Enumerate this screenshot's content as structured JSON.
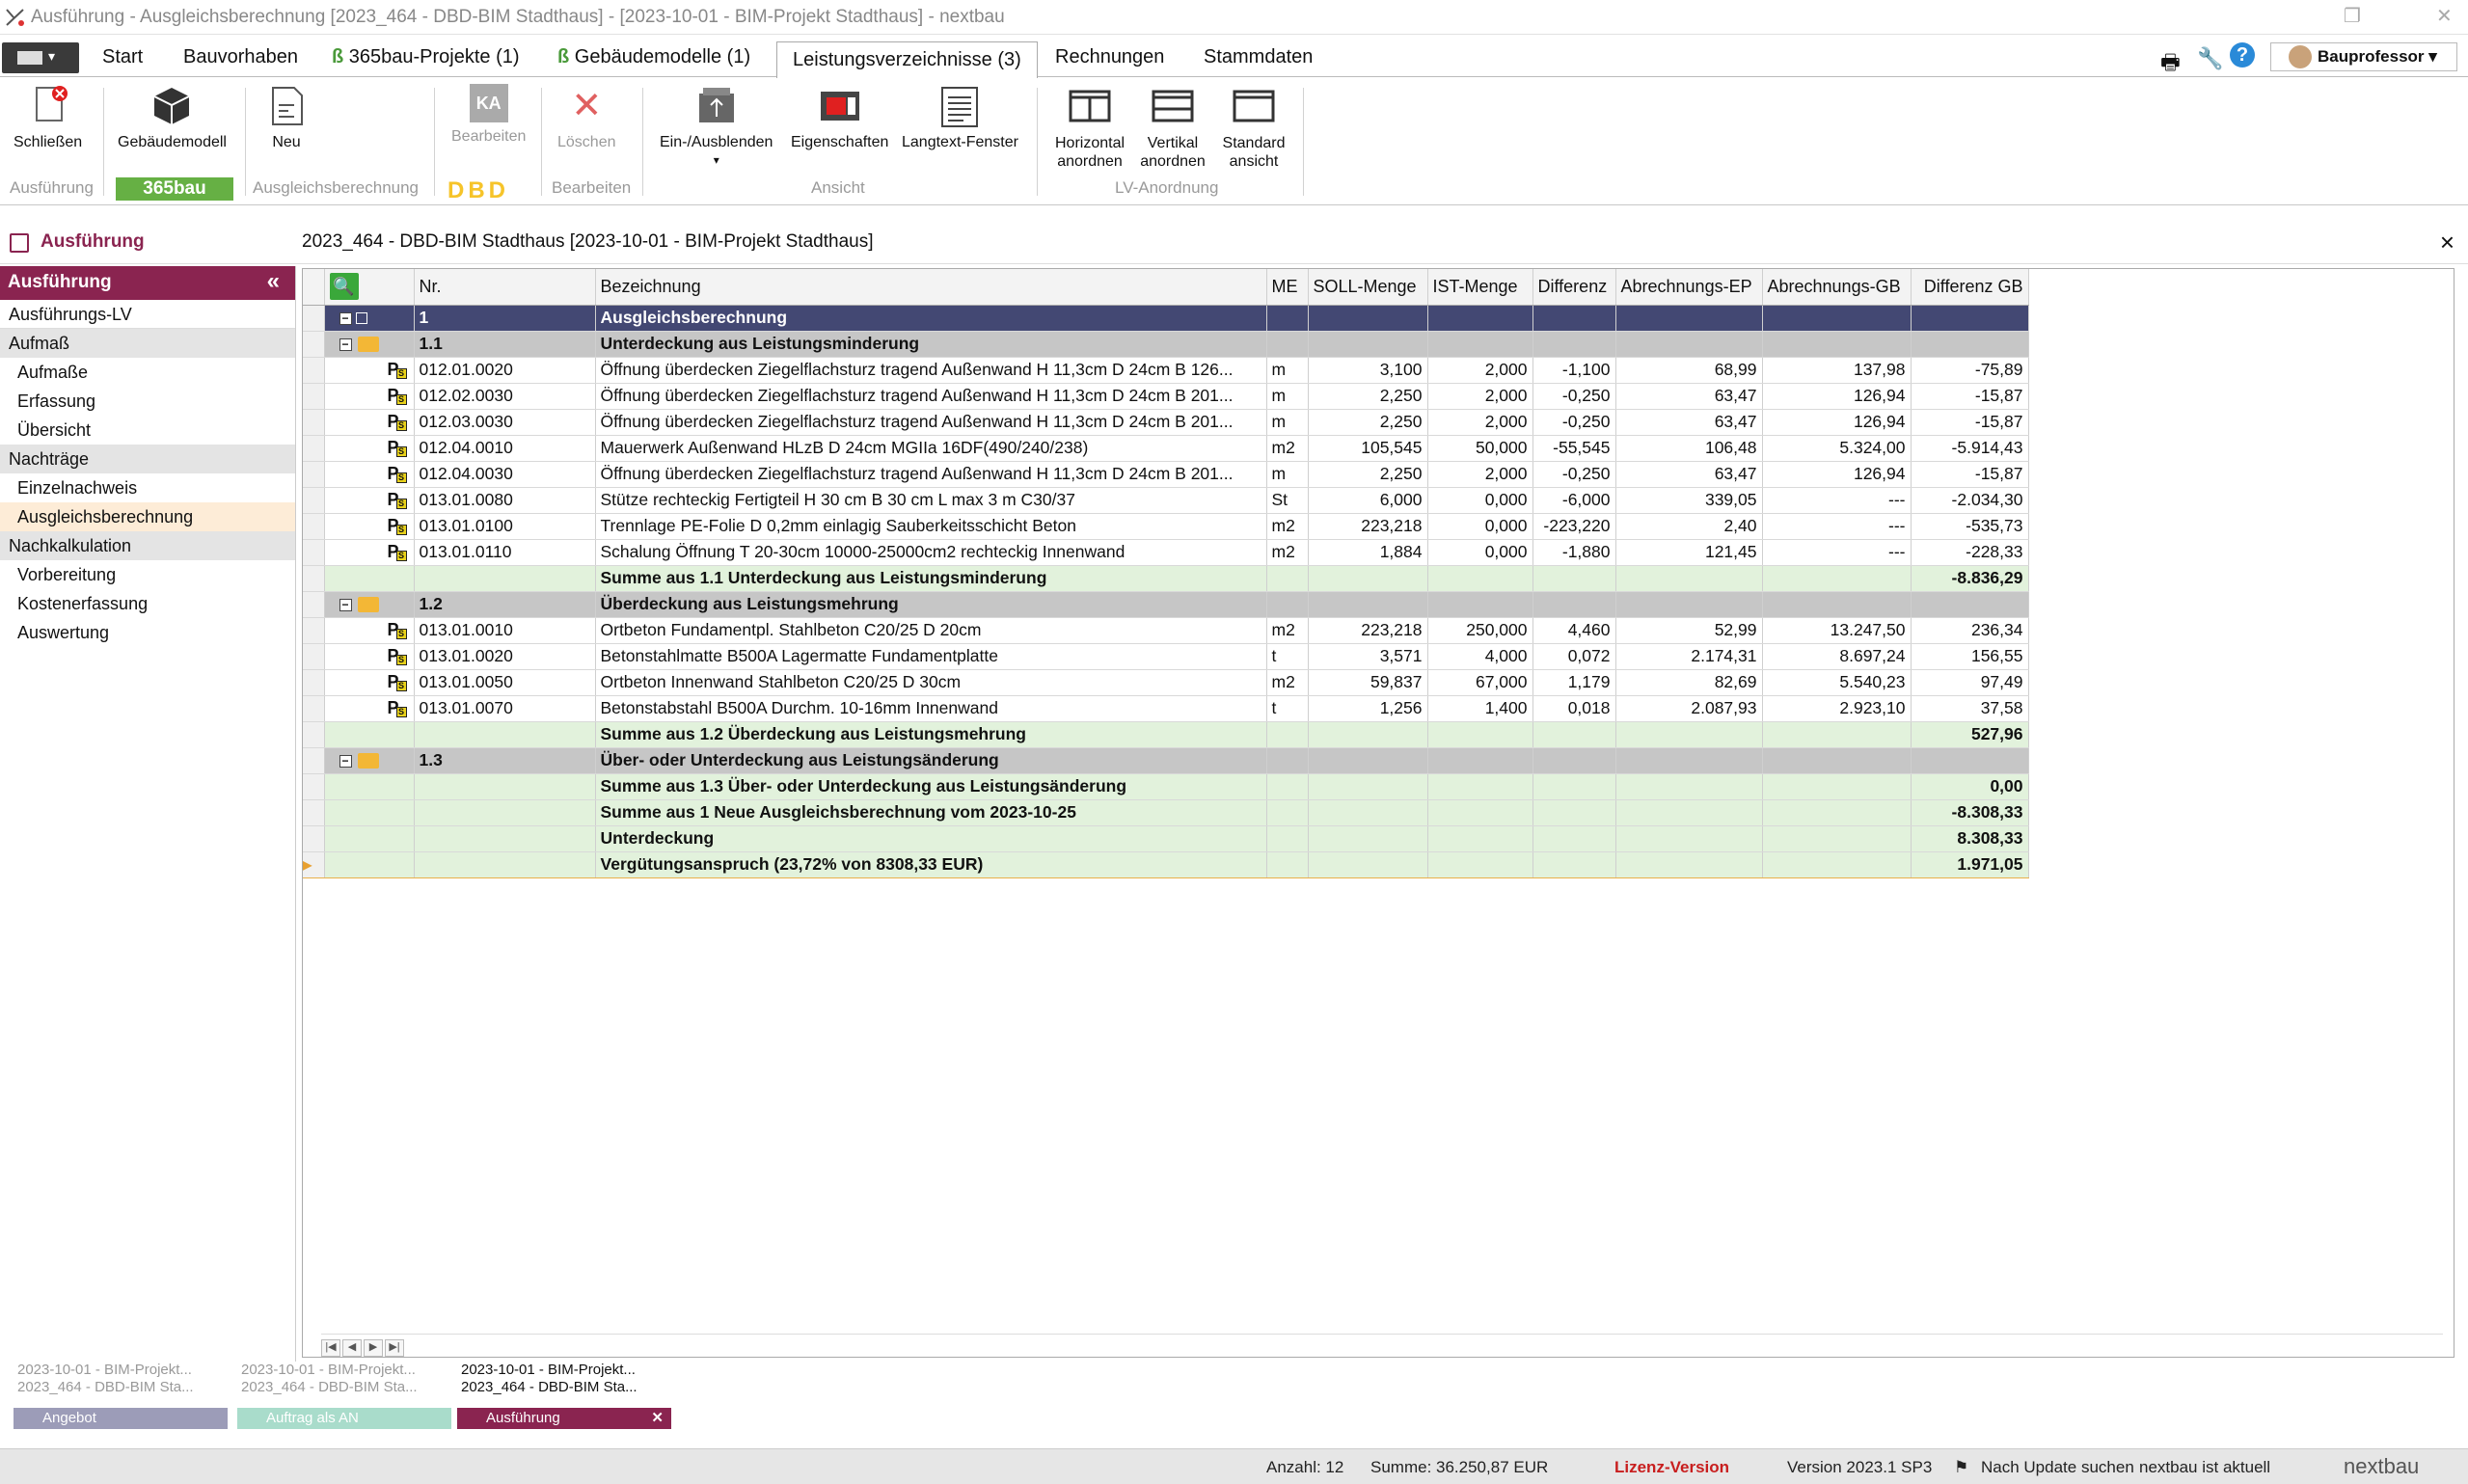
{
  "window": {
    "title": "Ausführung - Ausgleichsberechnung [2023_464 - DBD-BIM Stadthaus] - [2023-10-01 - BIM-Projekt Stadthaus] - nextbau"
  },
  "menu": {
    "tabs": [
      "Start",
      "Bauvorhaben",
      "365bau-Projekte (1)",
      "Gebäudemodelle (1)",
      "Leistungsverzeichnisse (3)",
      "Rechnungen",
      "Stammdaten"
    ],
    "user": "Bauprofessor"
  },
  "ribbon": {
    "buttons": {
      "close": "Schließen",
      "model": "Gebäudemodell",
      "new": "Neu",
      "ka": "KA",
      "edit": "Bearbeiten",
      "delete": "Löschen",
      "toggle": "Ein-/Ausblenden",
      "properties": "Eigenschaften",
      "longtext": "Langtext-Fenster",
      "horizontal": "Horizontal anordnen",
      "vertical": "Vertikal anordnen",
      "standard": "Standard ansicht"
    },
    "groups": {
      "ausfuehrung": "Ausführung",
      "badge365": "365bau",
      "ausgleich": "Ausgleichsberechnung",
      "dbd": "DBD",
      "bearbeiten": "Bearbeiten",
      "ansicht": "Ansicht",
      "lv": "LV-Anordnung"
    }
  },
  "header": {
    "section": "Ausführung",
    "document": "2023_464 - DBD-BIM Stadthaus [2023-10-01 - BIM-Projekt Stadthaus]"
  },
  "sidebar": {
    "title": "Ausführung",
    "items": [
      {
        "label": "Ausführungs-LV",
        "type": "item"
      },
      {
        "label": "Aufmaß",
        "type": "sec"
      },
      {
        "label": "Aufmaße",
        "type": "sub"
      },
      {
        "label": "Erfassung",
        "type": "sub"
      },
      {
        "label": "Übersicht",
        "type": "sub"
      },
      {
        "label": "Nachträge",
        "type": "sec"
      },
      {
        "label": "Einzelnachweis",
        "type": "sub"
      },
      {
        "label": "Ausgleichsberechnung",
        "type": "sub",
        "selected": true
      },
      {
        "label": "Nachkalkulation",
        "type": "sec"
      },
      {
        "label": "Vorbereitung",
        "type": "sub"
      },
      {
        "label": "Kostenerfassung",
        "type": "sub"
      },
      {
        "label": "Auswertung",
        "type": "sub"
      }
    ]
  },
  "grid": {
    "columns": [
      "Nr.",
      "Bezeichnung",
      "ME",
      "SOLL-Menge",
      "IST-Menge",
      "Differenz",
      "Abrechnungs-EP",
      "Abrechnungs-GB",
      "Differenz GB"
    ],
    "rows": [
      {
        "kind": "lvl0",
        "nr": "1",
        "text": "Ausgleichsberechnung"
      },
      {
        "kind": "lvl1",
        "nr": "1.1",
        "text": "Unterdeckung aus Leistungsminderung"
      },
      {
        "kind": "pos",
        "arrow": "down",
        "nr": "012.01.0020",
        "text": "Öffnung überdecken Ziegelflachsturz tragend Außenwand H 11,3cm D 24cm B 126...",
        "me": "m",
        "soll": "3,100",
        "ist": "2,000",
        "diff": "-1,100",
        "ep": "68,99",
        "gb": "137,98",
        "dgb": "-75,89"
      },
      {
        "kind": "pos",
        "arrow": "down",
        "nr": "012.02.0030",
        "text": "Öffnung überdecken Ziegelflachsturz tragend Außenwand H 11,3cm D 24cm B 201...",
        "me": "m",
        "soll": "2,250",
        "ist": "2,000",
        "diff": "-0,250",
        "ep": "63,47",
        "gb": "126,94",
        "dgb": "-15,87"
      },
      {
        "kind": "pos",
        "arrow": "down",
        "nr": "012.03.0030",
        "text": "Öffnung überdecken Ziegelflachsturz tragend Außenwand H 11,3cm D 24cm B 201...",
        "me": "m",
        "soll": "2,250",
        "ist": "2,000",
        "diff": "-0,250",
        "ep": "63,47",
        "gb": "126,94",
        "dgb": "-15,87"
      },
      {
        "kind": "pos",
        "arrow": "down",
        "nr": "012.04.0010",
        "text": "Mauerwerk Außenwand HLzB D 24cm MGIIa 16DF(490/240/238)",
        "me": "m2",
        "soll": "105,545",
        "ist": "50,000",
        "diff": "-55,545",
        "ep": "106,48",
        "gb": "5.324,00",
        "dgb": "-5.914,43"
      },
      {
        "kind": "pos",
        "arrow": "down",
        "nr": "012.04.0030",
        "text": "Öffnung überdecken Ziegelflachsturz tragend Außenwand H 11,3cm D 24cm B 201...",
        "me": "m",
        "soll": "2,250",
        "ist": "2,000",
        "diff": "-0,250",
        "ep": "63,47",
        "gb": "126,94",
        "dgb": "-15,87"
      },
      {
        "kind": "pos",
        "arrow": "minus",
        "nr": "013.01.0080",
        "text": "Stütze rechteckig Fertigteil H 30 cm B 30 cm L max 3 m C30/37",
        "me": "St",
        "soll": "6,000",
        "ist": "0,000",
        "diff": "-6,000",
        "ep": "339,05",
        "gb": "---",
        "dgb": "-2.034,30"
      },
      {
        "kind": "pos",
        "arrow": "minus",
        "nr": "013.01.0100",
        "text": "Trennlage PE-Folie D 0,2mm einlagig Sauberkeitsschicht Beton",
        "me": "m2",
        "soll": "223,218",
        "ist": "0,000",
        "diff": "-223,220",
        "ep": "2,40",
        "gb": "---",
        "dgb": "-535,73"
      },
      {
        "kind": "pos",
        "arrow": "minus",
        "nr": "013.01.0110",
        "text": "Schalung Öffnung T 20-30cm 10000-25000cm2 rechteckig Innenwand",
        "me": "m2",
        "soll": "1,884",
        "ist": "0,000",
        "diff": "-1,880",
        "ep": "121,45",
        "gb": "---",
        "dgb": "-228,33"
      },
      {
        "kind": "sum",
        "text": "Summe aus 1.1 Unterdeckung aus Leistungsminderung",
        "dgb": "-8.836,29"
      },
      {
        "kind": "lvl1",
        "nr": "1.2",
        "text": "Überdeckung aus Leistungsmehrung"
      },
      {
        "kind": "pos",
        "arrow": "up",
        "nr": "013.01.0010",
        "text": "Ortbeton Fundamentpl. Stahlbeton C20/25 D 20cm",
        "me": "m2",
        "soll": "223,218",
        "ist": "250,000",
        "diff": "4,460",
        "ep": "52,99",
        "gb": "13.247,50",
        "dgb": "236,34"
      },
      {
        "kind": "pos",
        "arrow": "up",
        "nr": "013.01.0020",
        "text": "Betonstahlmatte B500A Lagermatte Fundamentplatte",
        "me": "t",
        "soll": "3,571",
        "ist": "4,000",
        "diff": "0,072",
        "ep": "2.174,31",
        "gb": "8.697,24",
        "dgb": "156,55"
      },
      {
        "kind": "pos",
        "arrow": "up",
        "nr": "013.01.0050",
        "text": "Ortbeton Innenwand Stahlbeton C20/25 D 30cm",
        "me": "m2",
        "soll": "59,837",
        "ist": "67,000",
        "diff": "1,179",
        "ep": "82,69",
        "gb": "5.540,23",
        "dgb": "97,49"
      },
      {
        "kind": "pos",
        "arrow": "up",
        "nr": "013.01.0070",
        "text": "Betonstabstahl B500A Durchm. 10-16mm Innenwand",
        "me": "t",
        "soll": "1,256",
        "ist": "1,400",
        "diff": "0,018",
        "ep": "2.087,93",
        "gb": "2.923,10",
        "dgb": "37,58"
      },
      {
        "kind": "sum",
        "text": "Summe aus 1.2 Überdeckung aus Leistungsmehrung",
        "dgb": "527,96"
      },
      {
        "kind": "lvl1",
        "nr": "1.3",
        "text": "Über- oder Unterdeckung aus Leistungsänderung"
      },
      {
        "kind": "sum",
        "text": "Summe aus 1.3 Über- oder Unterdeckung aus Leistungsänderung",
        "dgb": "0,00"
      },
      {
        "kind": "sum",
        "text": "Summe aus 1 Neue Ausgleichsberechnung vom 2023-10-25",
        "dgb": "-8.308,33"
      },
      {
        "kind": "sum",
        "text": "Unterdeckung",
        "dgb": "8.308,33"
      },
      {
        "kind": "last",
        "text": "Vergütungsanspruch (23,72% von 8308,33 EUR)",
        "dgb": "1.971,05"
      }
    ]
  },
  "doctabs": [
    {
      "line1": "2023-10-01 - BIM-Projekt...",
      "line2": "2023_464 - DBD-BIM Sta...",
      "label": "Angebot",
      "color": "#9c9cb8"
    },
    {
      "line1": "2023-10-01 - BIM-Projekt...",
      "line2": "2023_464 - DBD-BIM Sta...",
      "label": "Auftrag als AN",
      "color": "#a9dccb"
    },
    {
      "line1": "2023-10-01 - BIM-Projekt...",
      "line2": "2023_464 - DBD-BIM Sta...",
      "label": "Ausführung",
      "color": "#8a2450"
    }
  ],
  "status": {
    "count": "Anzahl: 12",
    "sum": "Summe: 36.250,87 EUR",
    "license": "Lizenz-Version",
    "version": "Version 2023.1 SP3",
    "update": "Nach Update suchen",
    "uptodate": "nextbau ist aktuell",
    "brand": "nextbau"
  }
}
